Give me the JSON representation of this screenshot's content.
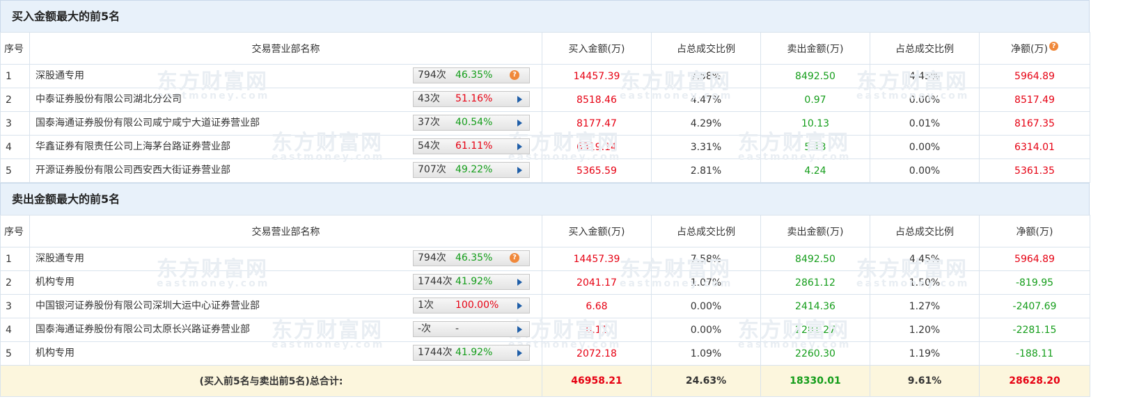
{
  "watermark": {
    "brand": "东方财富网",
    "domain": "eastmoney.com"
  },
  "columns": {
    "idx": "序号",
    "dept": "交易营业部名称",
    "buy": "买入金额(万)",
    "buy_ratio": "占总成交比例",
    "sell": "卖出金额(万)",
    "sell_ratio": "占总成交比例",
    "net": "净额(万)"
  },
  "buy_section": {
    "title": "买入金额最大的前5名",
    "rows": [
      {
        "idx": "1",
        "name": "深股通专用",
        "count": "794次",
        "pct": "46.35%",
        "pct_color": "green",
        "marker": "help",
        "buy": "14457.39",
        "buy_ratio": "7.58%",
        "sell": "8492.50",
        "sell_ratio": "4.45%",
        "net": "5964.89",
        "net_color": "red"
      },
      {
        "idx": "2",
        "name": "中泰证券股份有限公司湖北分公司",
        "count": "43次",
        "pct": "51.16%",
        "pct_color": "red",
        "marker": "arrow",
        "buy": "8518.46",
        "buy_ratio": "4.47%",
        "sell": "0.97",
        "sell_ratio": "0.00%",
        "net": "8517.49",
        "net_color": "red"
      },
      {
        "idx": "3",
        "name": "国泰海通证券股份有限公司咸宁咸宁大道证券营业部",
        "count": "37次",
        "pct": "40.54%",
        "pct_color": "green",
        "marker": "arrow",
        "buy": "8177.47",
        "buy_ratio": "4.29%",
        "sell": "10.13",
        "sell_ratio": "0.01%",
        "net": "8167.35",
        "net_color": "red"
      },
      {
        "idx": "4",
        "name": "华鑫证券有限责任公司上海茅台路证券营业部",
        "count": "54次",
        "pct": "61.11%",
        "pct_color": "red",
        "marker": "arrow",
        "buy": "6319.14",
        "buy_ratio": "3.31%",
        "sell": "5.13",
        "sell_ratio": "0.00%",
        "net": "6314.01",
        "net_color": "red"
      },
      {
        "idx": "5",
        "name": "开源证券股份有限公司西安西大街证券营业部",
        "count": "707次",
        "pct": "49.22%",
        "pct_color": "green",
        "marker": "arrow",
        "buy": "5365.59",
        "buy_ratio": "2.81%",
        "sell": "4.24",
        "sell_ratio": "0.00%",
        "net": "5361.35",
        "net_color": "red"
      }
    ]
  },
  "sell_section": {
    "title": "卖出金额最大的前5名",
    "rows": [
      {
        "idx": "1",
        "name": "深股通专用",
        "count": "794次",
        "pct": "46.35%",
        "pct_color": "green",
        "marker": "help",
        "buy": "14457.39",
        "buy_ratio": "7.58%",
        "sell": "8492.50",
        "sell_ratio": "4.45%",
        "net": "5964.89",
        "net_color": "red"
      },
      {
        "idx": "2",
        "name": "机构专用",
        "count": "1744次",
        "pct": "41.92%",
        "pct_color": "green",
        "marker": "arrow",
        "buy": "2041.17",
        "buy_ratio": "1.07%",
        "sell": "2861.12",
        "sell_ratio": "1.50%",
        "net": "-819.95",
        "net_color": "green"
      },
      {
        "idx": "3",
        "name": "中国银河证券股份有限公司深圳大运中心证券营业部",
        "count": "1次",
        "pct": "100.00%",
        "pct_color": "red",
        "marker": "arrow",
        "buy": "6.68",
        "buy_ratio": "0.00%",
        "sell": "2414.36",
        "sell_ratio": "1.27%",
        "net": "-2407.69",
        "net_color": "green"
      },
      {
        "idx": "4",
        "name": "国泰海通证券股份有限公司太原长兴路证券营业部",
        "count": "-次",
        "pct": "-",
        "pct_color": "dark",
        "marker": "arrow",
        "buy": "0.11",
        "buy_ratio": "0.00%",
        "sell": "2281.27",
        "sell_ratio": "1.20%",
        "net": "-2281.15",
        "net_color": "green"
      },
      {
        "idx": "5",
        "name": "机构专用",
        "count": "1744次",
        "pct": "41.92%",
        "pct_color": "green",
        "marker": "arrow",
        "buy": "2072.18",
        "buy_ratio": "1.09%",
        "sell": "2260.30",
        "sell_ratio": "1.19%",
        "net": "-188.11",
        "net_color": "green"
      }
    ]
  },
  "total": {
    "label_prefix": "(买入前5名与卖出前5名)",
    "label_bold": "总合计:",
    "buy": "46958.21",
    "buy_ratio": "24.63%",
    "sell": "18330.01",
    "sell_ratio": "9.61%",
    "net": "28628.20"
  },
  "colors": {
    "red": "#e60012",
    "green": "#149d1a",
    "header_bg": "#e8f1fa",
    "total_bg": "#fcf6dd",
    "help": "#f0883a",
    "arrow": "#1f5ea8"
  }
}
